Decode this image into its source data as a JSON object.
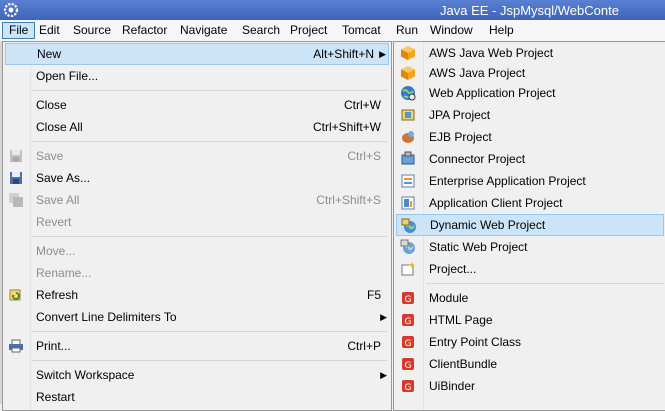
{
  "window": {
    "title": "Java EE - JspMysql/WebConte"
  },
  "menubar": {
    "items": [
      "File",
      "Edit",
      "Source",
      "Refactor",
      "Navigate",
      "Search",
      "Project",
      "Tomcat",
      "Run",
      "Window",
      "Help"
    ],
    "active": "File"
  },
  "file_menu": {
    "items": [
      {
        "label": "New",
        "shortcut": "Alt+Shift+N",
        "submenu": true,
        "state": "highlighted"
      },
      {
        "label": "Open File...",
        "shortcut": ""
      },
      {
        "label": "Close",
        "shortcut": "Ctrl+W"
      },
      {
        "label": "Close All",
        "shortcut": "Ctrl+Shift+W"
      },
      {
        "label": "Save",
        "shortcut": "Ctrl+S",
        "state": "disabled",
        "icon": "save-icon"
      },
      {
        "label": "Save As...",
        "shortcut": "",
        "icon": "save-as-icon"
      },
      {
        "label": "Save All",
        "shortcut": "Ctrl+Shift+S",
        "state": "disabled",
        "icon": "save-all-icon"
      },
      {
        "label": "Revert",
        "shortcut": "",
        "state": "disabled"
      },
      {
        "label": "Move...",
        "shortcut": "",
        "state": "disabled"
      },
      {
        "label": "Rename...",
        "shortcut": "",
        "state": "disabled"
      },
      {
        "label": "Refresh",
        "shortcut": "F5",
        "icon": "refresh-icon"
      },
      {
        "label": "Convert Line Delimiters To",
        "shortcut": "",
        "submenu": true
      },
      {
        "label": "Print...",
        "shortcut": "Ctrl+P",
        "icon": "print-icon"
      },
      {
        "label": "Switch Workspace",
        "shortcut": "",
        "submenu": true
      },
      {
        "label": "Restart",
        "shortcut": ""
      }
    ]
  },
  "new_submenu": {
    "items": [
      {
        "label": "AWS Java Web Project",
        "icon": "aws-cube-icon"
      },
      {
        "label": "AWS Java Project",
        "icon": "aws-cube-icon"
      },
      {
        "label": "Web Application Project",
        "icon": "globe-project-icon"
      },
      {
        "label": "JPA Project",
        "icon": "jpa-project-icon"
      },
      {
        "label": "EJB Project",
        "icon": "ejb-project-icon"
      },
      {
        "label": "Connector Project",
        "icon": "connector-project-icon"
      },
      {
        "label": "Enterprise Application Project",
        "icon": "enterprise-project-icon"
      },
      {
        "label": "Application Client Project",
        "icon": "app-client-project-icon"
      },
      {
        "label": "Dynamic Web Project",
        "icon": "dynamic-web-project-icon",
        "state": "highlighted"
      },
      {
        "label": "Static Web Project",
        "icon": "static-web-project-icon"
      },
      {
        "label": "Project...",
        "icon": "new-project-icon"
      },
      {
        "label": "Module",
        "icon": "gwt-icon"
      },
      {
        "label": "HTML Page",
        "icon": "gwt-icon"
      },
      {
        "label": "Entry Point Class",
        "icon": "gwt-icon"
      },
      {
        "label": "ClientBundle",
        "icon": "gwt-icon"
      },
      {
        "label": "UiBinder",
        "icon": "gwt-icon"
      }
    ]
  },
  "colors": {
    "highlight": "#cce4f7",
    "highlight_border": "#9ac7ef",
    "titlebar": "#4a6fc0",
    "disabled_text": "#8d8d8d"
  }
}
